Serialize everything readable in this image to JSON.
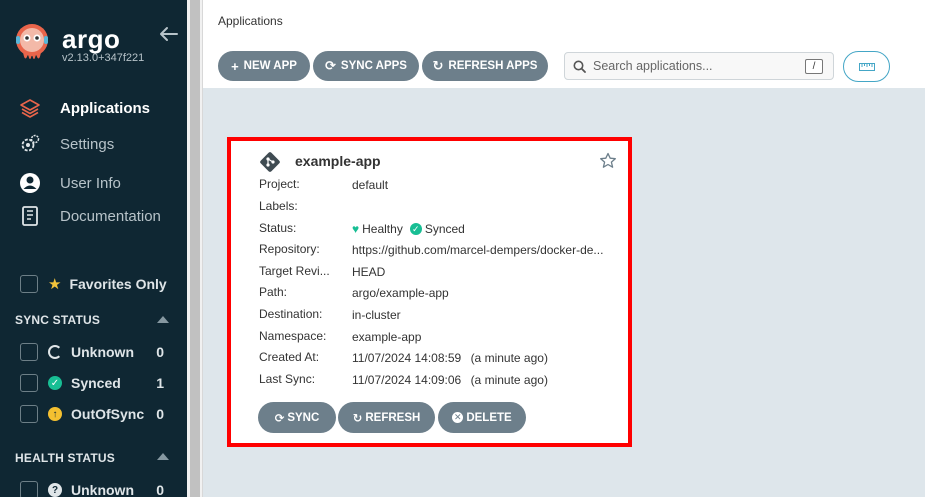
{
  "sidebar": {
    "brand": "argo",
    "version": "v2.13.0+347f221",
    "nav": [
      {
        "label": "Applications"
      },
      {
        "label": "Settings"
      },
      {
        "label": "User Info"
      },
      {
        "label": "Documentation"
      }
    ],
    "favorites_label": "Favorites Only",
    "sync_status": {
      "title": "SYNC STATUS",
      "items": [
        {
          "label": "Unknown",
          "count": "0"
        },
        {
          "label": "Synced",
          "count": "1"
        },
        {
          "label": "OutOfSync",
          "count": "0"
        }
      ]
    },
    "health_status": {
      "title": "HEALTH STATUS",
      "items": [
        {
          "label": "Unknown",
          "count": "0"
        }
      ]
    }
  },
  "header": {
    "breadcrumb": "Applications",
    "buttons": {
      "new_app": "NEW APP",
      "sync_apps": "SYNC APPS",
      "refresh_apps": "REFRESH APPS"
    },
    "search": {
      "placeholder": "Search applications...",
      "shortcut": "/"
    }
  },
  "app_card": {
    "name": "example-app",
    "fields": [
      {
        "key": "Project:",
        "value": "default"
      },
      {
        "key": "Labels:",
        "value": ""
      },
      {
        "key": "Status:",
        "health": "Healthy",
        "sync": "Synced"
      },
      {
        "key": "Repository:",
        "value": "https://github.com/marcel-dempers/docker-de..."
      },
      {
        "key": "Target Revi...",
        "value": "HEAD"
      },
      {
        "key": "Path:",
        "value": "argo/example-app"
      },
      {
        "key": "Destination:",
        "value": "in-cluster"
      },
      {
        "key": "Namespace:",
        "value": "example-app"
      },
      {
        "key": "Created At:",
        "value": "11/07/2024 14:08:59",
        "extra": "(a minute ago)"
      },
      {
        "key": "Last Sync:",
        "value": "11/07/2024 14:09:06",
        "extra": "(a minute ago)"
      }
    ],
    "buttons": {
      "sync": "SYNC",
      "refresh": "REFRESH",
      "delete": "DELETE"
    }
  },
  "colors": {
    "sidebar_bg": "#0f2733",
    "button_gray": "#6d7f8b",
    "healthy_green": "#18be94",
    "highlight_red": "#ff0000",
    "accent_blue": "#44a6c6",
    "warning_orange": "#f4c030"
  },
  "icons": {
    "logo": "argo-octopus-logo",
    "collapse": "arrow-left-icon",
    "nav": [
      "layers-icon",
      "gears-icon",
      "user-circle-icon",
      "book-icon"
    ],
    "favorites": "star-icon",
    "view_toggle": "ruler-icon",
    "card": "git-icon"
  }
}
